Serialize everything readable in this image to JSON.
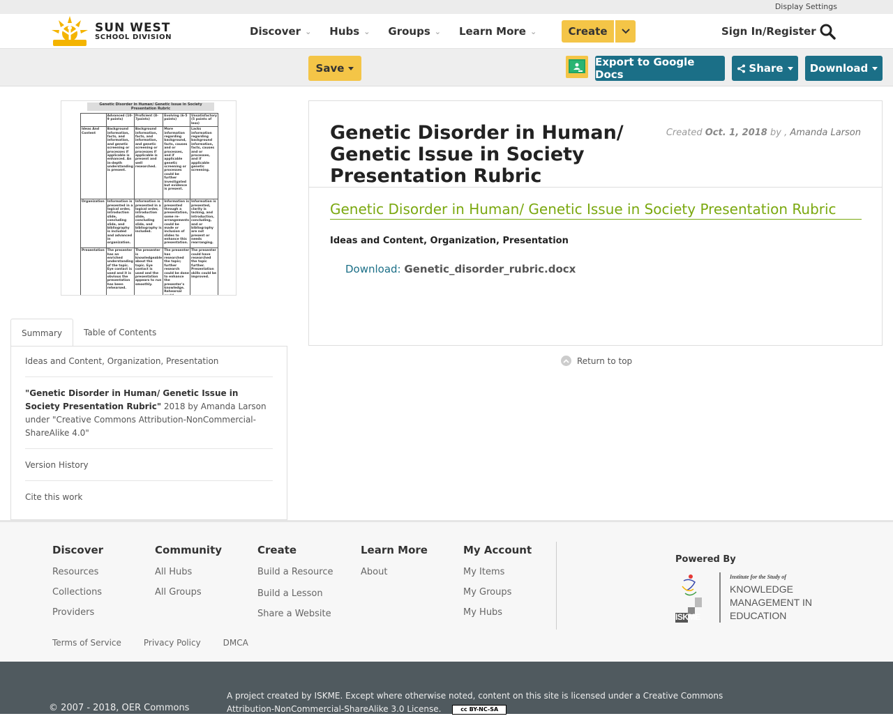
{
  "topbar": {
    "display_settings": "Display Settings"
  },
  "brand": {
    "line1": "SUN WEST",
    "line2": "SCHOOL DIVISION"
  },
  "nav": {
    "items": [
      {
        "label": "Discover"
      },
      {
        "label": "Hubs"
      },
      {
        "label": "Groups"
      },
      {
        "label": "Learn More"
      }
    ],
    "create_label": "Create",
    "signin_label": "Sign In/Register"
  },
  "toolbar": {
    "save_label": "Save",
    "export_label": "Export to Google Docs",
    "share_label": "Share",
    "download_label": "Download"
  },
  "thumbnail": {
    "title": "Genetic Disorder in Human/ Genetic Issue in Society Presentation Rubric",
    "headers": [
      "",
      "Advanced (10-9 points)",
      "Proficient (8-7points)",
      "Evolving (6-5 points)",
      "Unsatisfactory (5 points of less)"
    ],
    "rows": [
      [
        "Ideas And Content",
        "Background information, facts, and information, and genetic screening or processes if applicable is enhanced. An in-depth understanding is present.",
        "Background information, facts, and information, and genetic screening or processes if applicable is present and well researched.",
        "More information regarding background, facts, causes and or processes, and if applicable genetic screening or processes could be further investigated but evidence is present.",
        "Lacks information regarding background information, facts, causes and or processes, and if applicable genetic screening."
      ],
      [
        "Organization",
        "Information is presented in a logical order, introduction slide, concluding slide, and bibliography is included and advanced in organization.",
        "Information is presented in a logical order, introduction slide, concluding slide, and bibliography is included.",
        "Information is presented through a presentation, some re-arrangements could be made or inclusion of slides to enhance this presentation.",
        "Information is presented, clarity is lacking, and introduction, concluding, and or bibliography are not present or needs rearranging."
      ],
      [
        "Presentation",
        "The presenter has an enriched understanding of the topic. Eye contact is used and it is obvious the presentation has been rehearsed.",
        "The presenter is knowledgeable about the topic. Eye contact is used and the presentation appears to run smoothly.",
        "The presenter has researched the topic; further research could be done to enhance the presenter's knowledge. Rehearsal could improve the",
        "The presenter could have researched the topic further. Presentation skills could be improved."
      ]
    ]
  },
  "tabs": [
    {
      "label": "Summary"
    },
    {
      "label": "Table of Contents"
    }
  ],
  "summary": {
    "keywords": "Ideas and Content, Organization, Presentation",
    "citation_title": "\"Genetic Disorder in Human/ Genetic Issue in Society Presentation Rubric\"",
    "citation_rest": " 2018 by Amanda Larson under \"Creative Commons Attribution-NonCommercial-ShareAlike 4.0\"",
    "version_history": "Version History",
    "cite": "Cite this work"
  },
  "resource": {
    "title": "Genetic Disorder in Human/ Genetic Issue in Society Presentation Rubric",
    "created_label": "Created",
    "created_date": "Oct. 1, 2018",
    "by_label": "by ,",
    "author": "Amanda Larson",
    "link_text": "Genetic Disorder in Human/ Genetic Issue in Society Presentation Rubric",
    "keywords": "Ideas and Content, Organization, Presentation",
    "download_label": "Download:",
    "download_file": "Genetic_disorder_rubric.docx"
  },
  "return_to_top": "Return to top",
  "footer": {
    "columns": [
      {
        "heading": "Discover",
        "links": [
          "Resources",
          "Collections",
          "Providers"
        ]
      },
      {
        "heading": "Community",
        "links": [
          "All Hubs",
          "All Groups"
        ]
      },
      {
        "heading": "Create",
        "links": [
          "Build a Resource",
          "Build a Lesson",
          "Share a Website"
        ]
      },
      {
        "heading": "Learn More",
        "links": [
          "About"
        ]
      },
      {
        "heading": "My Account",
        "links": [
          "My Items",
          "My Groups",
          "My Hubs"
        ]
      }
    ],
    "powered_by": "Powered By",
    "iskme_line1": "Institute for the Study of",
    "iskme_line2": "KNOWLEDGE",
    "iskme_line3": "MANAGEMENT IN",
    "iskme_line4": "EDUCATION",
    "iskme_abbr": "ISKME",
    "legal": [
      "Terms of Service",
      "Privacy Policy",
      "DMCA"
    ]
  },
  "bottom": {
    "copyright": "© 2007 - 2018, OER Commons",
    "project": "A project created by ISKME. Except where otherwise noted, content on this site is licensed under a Creative Commons Attribution-NonCommercial-ShareAlike 3.0 License.",
    "cc_badge": "cc BY-NC-SA"
  },
  "colors": {
    "accent_yellow": "#f4c547",
    "teal": "#1b6f87",
    "link_green": "#7aa80f"
  }
}
